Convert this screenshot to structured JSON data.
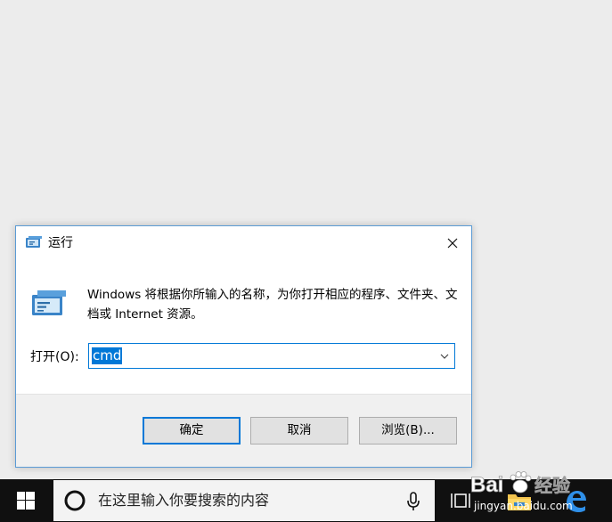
{
  "dialog": {
    "title": "运行",
    "description": "Windows 将根据你所输入的名称，为你打开相应的程序、文件夹、文档或 Internet 资源。",
    "open_label": "打开(O):",
    "command_value": "cmd",
    "buttons": {
      "ok": "确定",
      "cancel": "取消",
      "browse": "浏览(B)..."
    }
  },
  "taskbar": {
    "search_placeholder": "在这里输入你要搜索的内容"
  },
  "icons": {
    "run": "run-icon",
    "close": "close-icon",
    "dropdown": "chevron-down-icon",
    "start": "windows-logo-icon",
    "search": "cortana-circle-icon",
    "mic": "microphone-icon",
    "task_view": "task-view-icon",
    "explorer": "file-explorer-icon",
    "edge": "edge-browser-icon"
  },
  "watermark": {
    "brand": "Bai 经验",
    "url": "jingyan.baidu.com"
  },
  "colors": {
    "accent": "#0078d7",
    "taskbar": "#101010",
    "desktop": "#ececec"
  }
}
